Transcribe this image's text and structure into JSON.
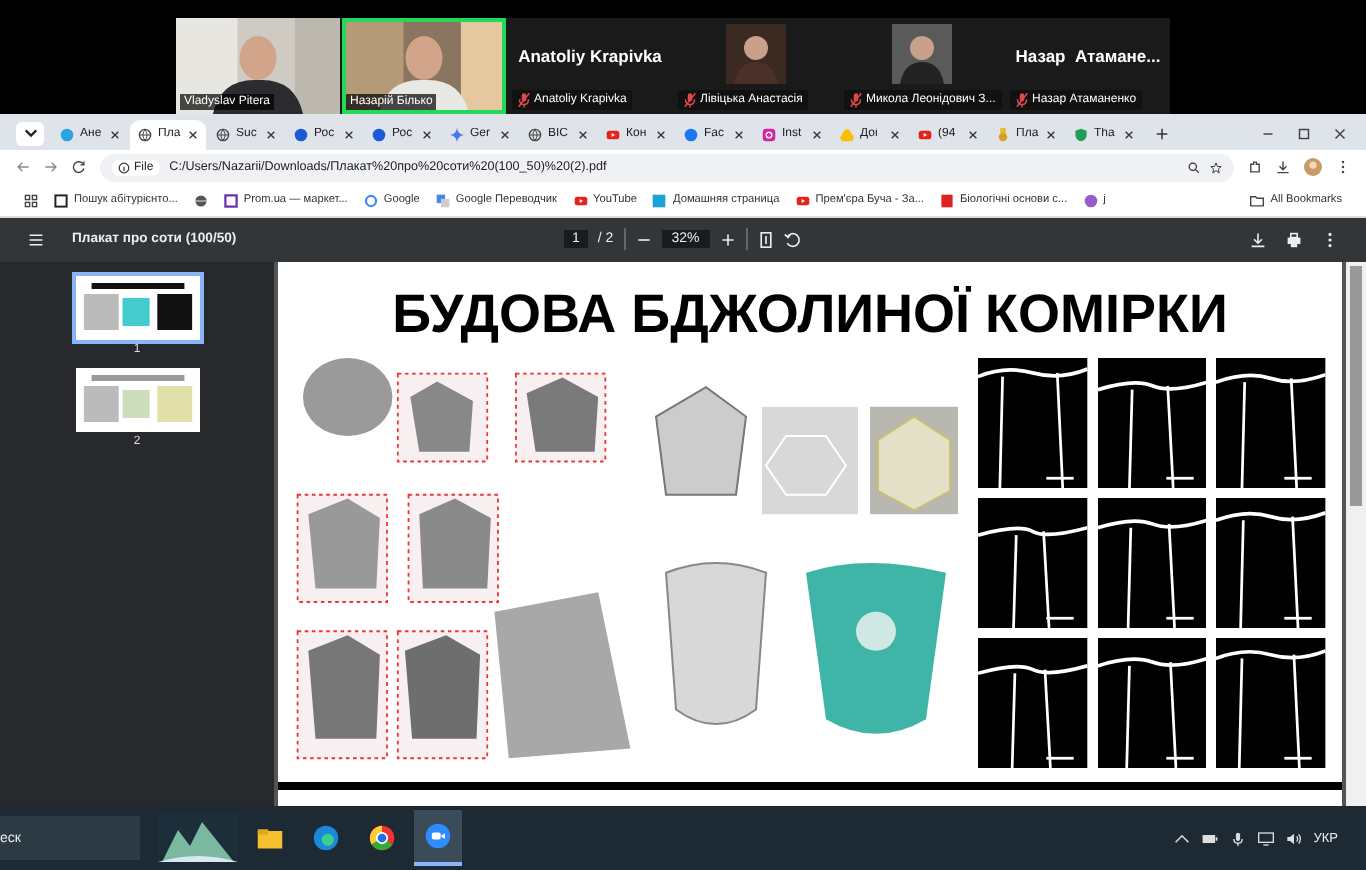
{
  "meeting": {
    "participants": [
      {
        "kind": "video",
        "name": "Vladyslav Pitera",
        "speaking": false,
        "muted": false
      },
      {
        "kind": "video",
        "name": "Назарій Білько",
        "speaking": true,
        "muted": false
      },
      {
        "kind": "name",
        "display_name": "Anatoliy Krapivka",
        "name": "Anatoliy Krapivka",
        "speaking": false,
        "muted": true
      },
      {
        "kind": "avatar",
        "name": "Лівіцька Анастасія",
        "speaking": false,
        "muted": true
      },
      {
        "kind": "avatar",
        "name": "Микола Леонідович З...",
        "speaking": false,
        "muted": true
      },
      {
        "kind": "name",
        "display_name": "Назар  Атамане...",
        "name": "Назар Атаманенко",
        "speaking": false,
        "muted": true
      }
    ]
  },
  "browser": {
    "tabs": [
      {
        "label": "Ане",
        "selected": false
      },
      {
        "label": "Пла",
        "selected": true
      },
      {
        "label": "Suc",
        "selected": false
      },
      {
        "label": "Рос",
        "selected": false
      },
      {
        "label": "Рос",
        "selected": false
      },
      {
        "label": "Ger",
        "selected": false
      },
      {
        "label": "ВІС",
        "selected": false
      },
      {
        "label": "Кон",
        "selected": false
      },
      {
        "label": "Fac",
        "selected": false
      },
      {
        "label": "Inst",
        "selected": false
      },
      {
        "label": "Доі",
        "selected": false
      },
      {
        "label": "(94",
        "selected": false
      },
      {
        "label": "Пла",
        "selected": false
      },
      {
        "label": "Tha",
        "selected": false
      }
    ],
    "address": {
      "scheme": "File",
      "url": "C:/Users/Nazarii/Downloads/Плакат%20про%20соти%20(100_50)%20(2).pdf"
    },
    "bookmarks": [
      {
        "label": "Пошук абітурієнто..."
      },
      {
        "label": "Prom.ua — маркет..."
      },
      {
        "label": "Google"
      },
      {
        "label": "Google Переводчик"
      },
      {
        "label": "YouTube"
      },
      {
        "label": "Домашняя страница"
      },
      {
        "label": "Прем'єра Буча - За..."
      },
      {
        "label": "Біологічні основи с..."
      },
      {
        "label": "j"
      }
    ],
    "all_bookmarks": "All Bookmarks"
  },
  "pdf": {
    "title": "Плакат про соти (100/50)",
    "page": "1",
    "page_total": "/ 2",
    "zoom": "32%",
    "thumbnails": [
      {
        "label": "1",
        "selected": true
      },
      {
        "label": "2",
        "selected": false
      }
    ],
    "poster": {
      "title": "БУДОВА БДЖОЛИНОЇ КОМІРКИ"
    }
  },
  "taskbar": {
    "search": "еск",
    "apps": [
      {
        "selected": false
      },
      {
        "selected": false
      },
      {
        "selected": false
      },
      {
        "selected": true
      }
    ],
    "language": "УКР"
  }
}
